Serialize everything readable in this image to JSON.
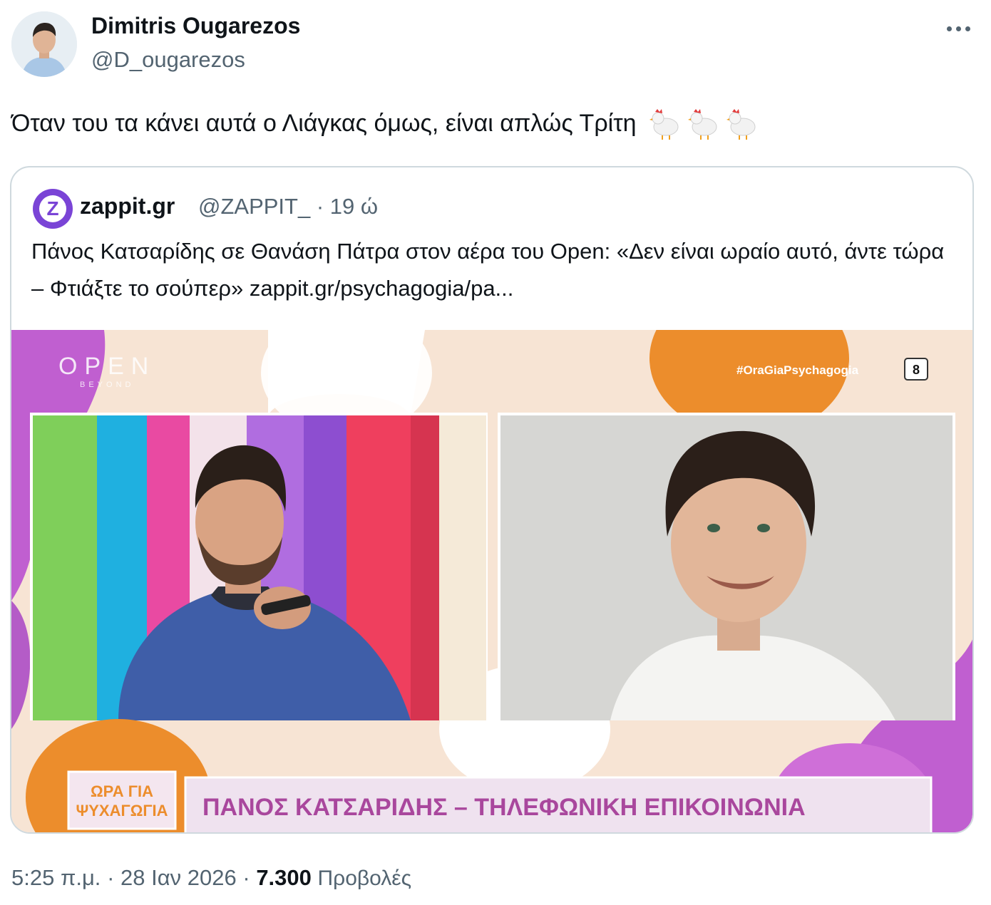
{
  "tweet": {
    "author": {
      "name": "Dimitris Ougarezos",
      "handle": "@D_ougarezos",
      "avatar_icon": "profile-photo"
    },
    "more_icon": "more-dots-icon",
    "text": "Όταν του τα κάνει αυτά ο Λιάγκας όμως, είναι απλώς Τρίτη",
    "emojis": [
      "chicken",
      "chicken",
      "chicken"
    ],
    "quote": {
      "logo_letter": "Z",
      "name": "zappit.gr",
      "handle_time": "@ZAPPIT_ · 19 ώ",
      "text": "Πάνος Κατσαρίδης σε Θανάση Πάτρα στον αέρα του Open: «Δεν είναι ωραίο αυτό, άντε τώρα – Φτιάξτε το σούπερ» zappit.gr/psychagogia/pa...",
      "media": {
        "channel_logo": "OPEN",
        "channel_tagline": "BEYOND",
        "hashtag": "#OraGiaPsychagogia",
        "rating_badge": "8",
        "show_logo_line1": "ΩΡΑ ΓΙΑ",
        "show_logo_line2": "ΨΥΧΑΓΩΓΙΑ",
        "lower_third": "ΠΑΝΟΣ ΚΑΤΣΑΡΙΔΗΣ – ΤΗΛΕΦΩΝΙΚΗ ΕΠΙΚΟΙΝΩΝΙΑ"
      }
    },
    "time": "5:25 π.μ.",
    "separator": "·",
    "date": "28 Ιαν 2026",
    "views_count": "7.300",
    "views_label": "Προβολές"
  },
  "colors": {
    "text": "#0f1419",
    "secondary": "#536471",
    "border": "#cfd9de",
    "zappit_purple": "#7a44d6",
    "broadcast_purple": "#c05fd0",
    "broadcast_orange": "#ec8d2c",
    "lower_third_text": "#a9479d"
  }
}
